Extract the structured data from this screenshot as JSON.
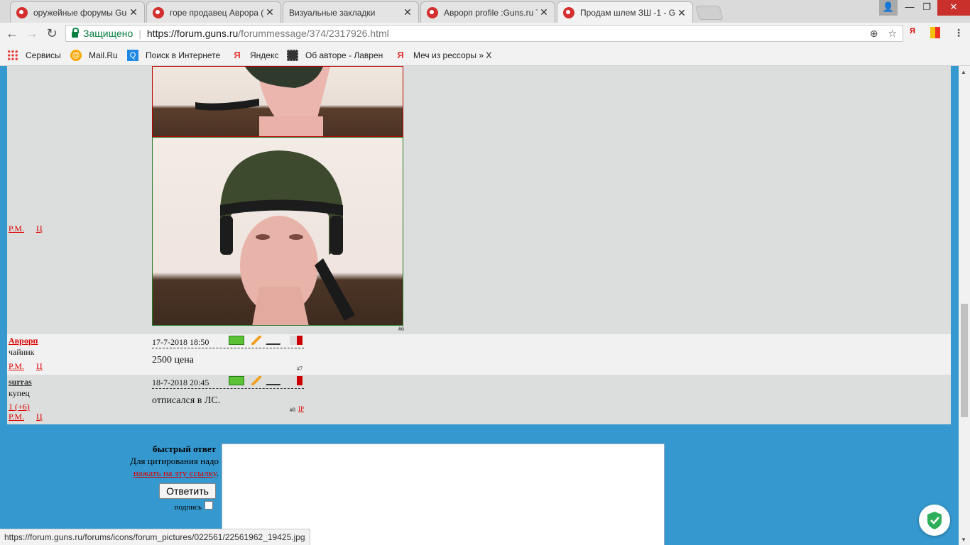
{
  "tabs": [
    {
      "title": "оружейные форумы Guns",
      "favicon": true
    },
    {
      "title": "горе продавец Аврора (",
      "favicon": true
    },
    {
      "title": "Визуальные закладки",
      "favicon": false
    },
    {
      "title": "Аврорп profile :Guns.ru T",
      "favicon": true
    },
    {
      "title": "Продам шлем ЗШ -1 - G",
      "favicon": true,
      "active": true
    }
  ],
  "toolbar": {
    "secure_label": "Защищено",
    "url_host": "https://forum.guns.ru",
    "url_path": "/forummessage/374/2317926.html"
  },
  "bookmarks": [
    {
      "label": "Сервисы",
      "icon": "apps-icon"
    },
    {
      "label": "Mail.Ru",
      "icon": "mailru-icon"
    },
    {
      "label": "Поиск в Интернете",
      "icon": "search-icon"
    },
    {
      "label": "Яндекс",
      "icon": "yandex-icon"
    },
    {
      "label": "Об авторе - Лаврен",
      "icon": "film-icon"
    },
    {
      "label": "Меч из рессоры » Х",
      "icon": "yandex-icon"
    }
  ],
  "posts": {
    "p6": {
      "pm": "P.M.",
      "u": "Ц",
      "num": "#6"
    },
    "p7": {
      "author": "Аврорп",
      "rank": "чайник",
      "date": "17-7-2018 18:50",
      "text": "2500 цена",
      "pm": "P.M.",
      "u": "Ц",
      "num": "#7"
    },
    "p8": {
      "author": "surras",
      "rank": "купец",
      "rating": "1 (+6)",
      "date": "18-7-2018 20:45",
      "text": "отписался в ЛС.",
      "pm": "P.M.",
      "u": "Ц",
      "num": "#8",
      "ip": "IP"
    }
  },
  "quick_reply": {
    "title": "быстрый ответ",
    "quote_hint": "Для цитирования надо",
    "quote_link": "нажать на эту ссылку",
    "quote_dot": ".",
    "reply_button": "Ответить",
    "signature_label": "подпись"
  },
  "status_url": "https://forum.guns.ru/forums/icons/forum_pictures/022561/22561962_19425.jpg",
  "colors": {
    "page_bg": "#3598cf",
    "link_red": "#dd0000",
    "secure_green": "#0b8043"
  }
}
